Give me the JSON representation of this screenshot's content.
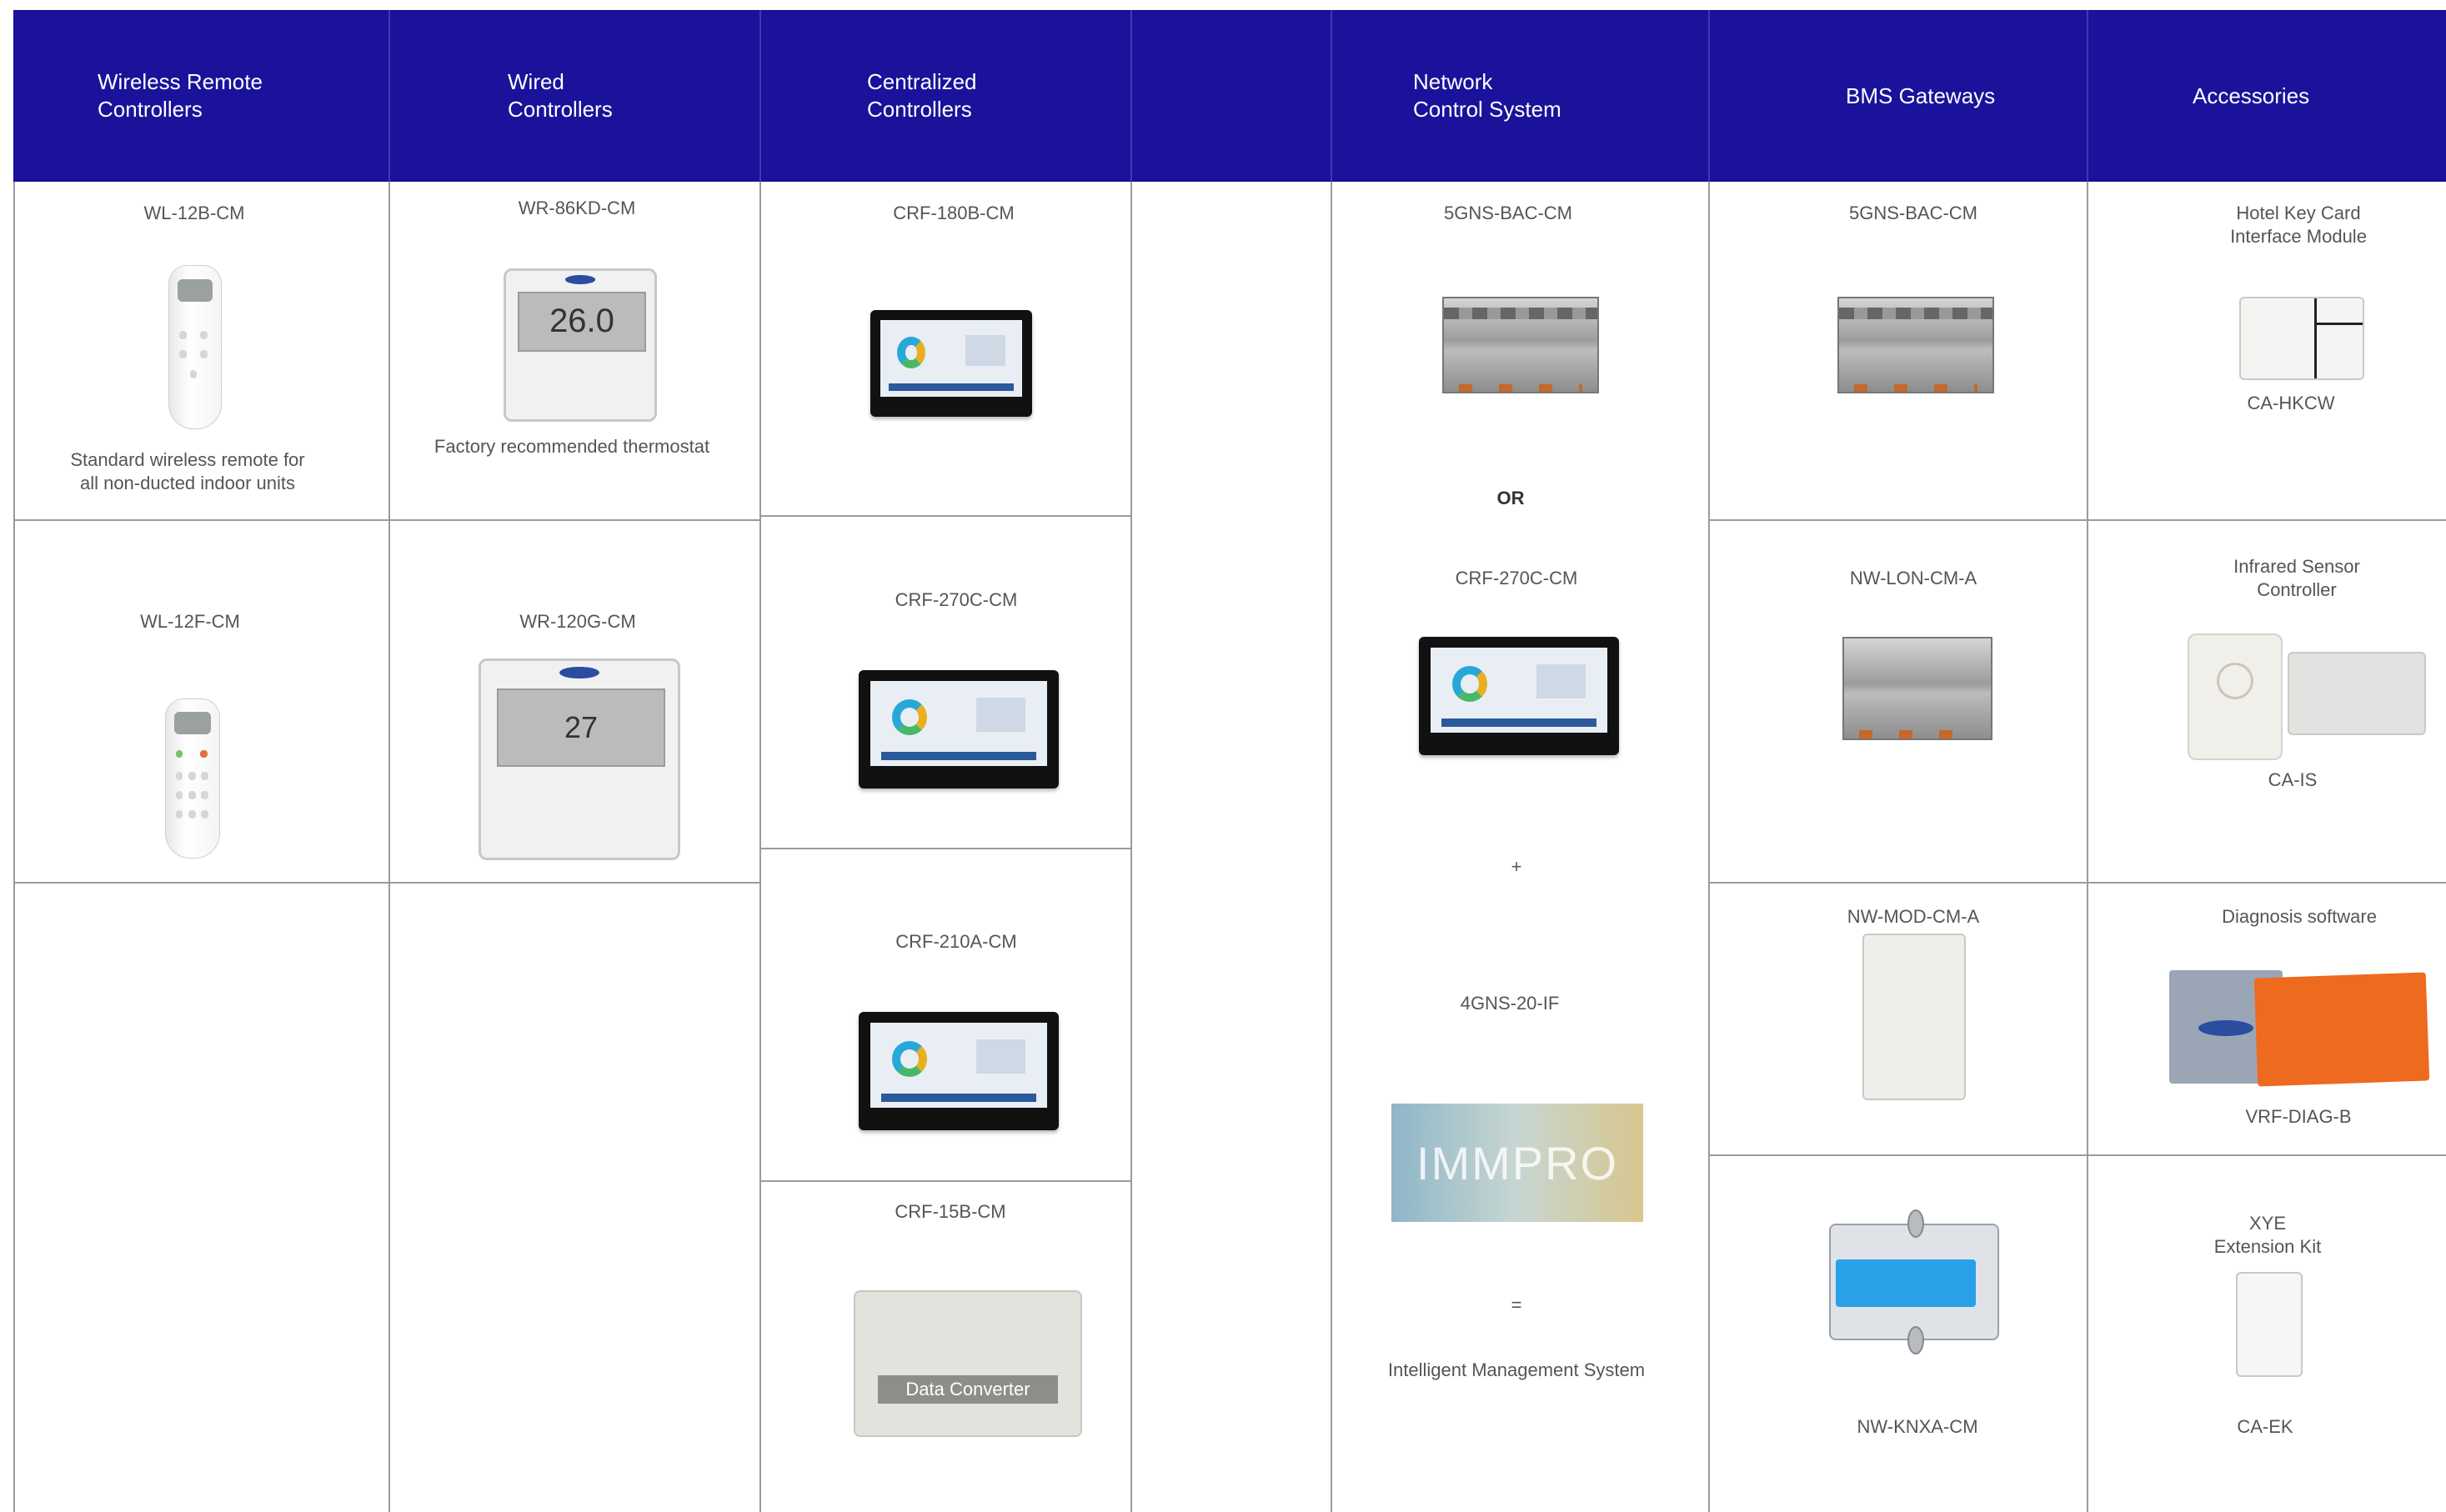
{
  "colors": {
    "header_bg": "#1a129a",
    "header_text": "#ffffff",
    "grid_line": "#9a9aa0",
    "text": "#555555"
  },
  "columns": {
    "wireless": [
      "Wireless Remote",
      "Controllers"
    ],
    "wired": [
      "Wired",
      "Controllers"
    ],
    "centralized": [
      "Centralized",
      "Controllers"
    ],
    "network": [
      "Network",
      "Control System"
    ],
    "bms": "BMS Gateways",
    "accessories": "Accessories"
  },
  "wireless": {
    "item1": {
      "model": "WL-12B-CM",
      "desc": [
        "Standard wireless remote for",
        "all non-ducted indoor units"
      ]
    },
    "item2": {
      "model": "WL-12F-CM"
    }
  },
  "wired": {
    "item1": {
      "model": "WR-86KD-CM",
      "desc": "Factory recommended thermostat",
      "display": "26.0"
    },
    "item2": {
      "model": "WR-120G-CM",
      "display": "27"
    }
  },
  "centralized": {
    "item1": {
      "model": "CRF-180B-CM"
    },
    "item2": {
      "model": "CRF-270C-CM"
    },
    "item3": {
      "model": "CRF-210A-CM"
    },
    "item4": {
      "model": "CRF-15B-CM",
      "device_text": "Data Converter"
    }
  },
  "network": {
    "model1": "5GNS-BAC-CM",
    "or": "OR",
    "model2": "CRF-270C-CM",
    "plus": "+",
    "model3": "4GNS-20-IF",
    "software_text": "IMMPRO",
    "equals": "=",
    "result": "Intelligent Management System"
  },
  "bms": {
    "item1": {
      "model": "5GNS-BAC-CM"
    },
    "item2": {
      "model": "NW-LON-CM-A"
    },
    "item3": {
      "model": "NW-MOD-CM-A"
    },
    "item4": {
      "model": "NW-KNXA-CM"
    }
  },
  "accessories": {
    "item1": {
      "title": [
        "Hotel Key Card",
        "Interface Module"
      ],
      "model": "CA-HKCW"
    },
    "item2": {
      "title": [
        "Infrared Sensor",
        "Controller"
      ],
      "model": "CA-IS"
    },
    "item3": {
      "title": "Diagnosis software",
      "model": "VRF-DIAG-B"
    },
    "item4": {
      "title": [
        "XYE",
        "Extension Kit"
      ],
      "model": "CA-EK"
    }
  }
}
